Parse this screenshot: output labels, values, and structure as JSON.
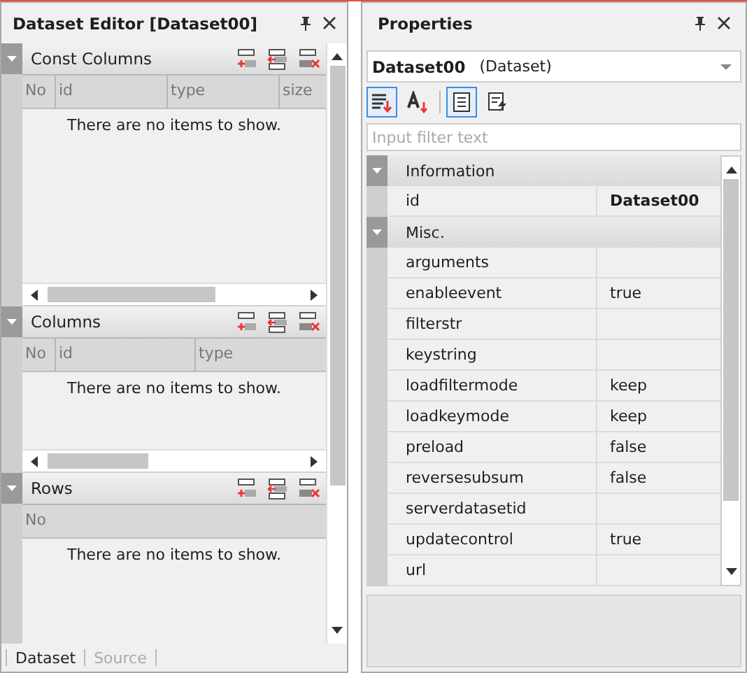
{
  "dataset_editor": {
    "title": "Dataset Editor [Dataset00]",
    "sections": [
      {
        "title": "Const Columns",
        "expanded": true,
        "columns": [
          "No",
          "id",
          "type",
          "size"
        ],
        "empty_text": "There are no items to show."
      },
      {
        "title": "Columns",
        "expanded": true,
        "columns": [
          "No",
          "id",
          "type"
        ],
        "empty_text": "There are no items to show."
      },
      {
        "title": "Rows",
        "expanded": true,
        "columns": [
          "No"
        ],
        "empty_text": "There are no items to show."
      }
    ],
    "tabs": [
      {
        "label": "Dataset",
        "selected": true
      },
      {
        "label": "Source",
        "selected": false
      }
    ]
  },
  "properties": {
    "title": "Properties",
    "object": {
      "name": "Dataset00",
      "type": "(Dataset)"
    },
    "toolbar": [
      {
        "kind": "categorized",
        "selected": true
      },
      {
        "kind": "alphabetical",
        "selected": false
      },
      {
        "kind": "properties",
        "selected": true
      },
      {
        "kind": "events",
        "selected": false
      }
    ],
    "filter": {
      "placeholder": "Input filter text"
    },
    "categories": [
      {
        "name": "Information",
        "expanded": true,
        "rows": [
          {
            "name": "id",
            "value": "Dataset00",
            "bold": true
          }
        ]
      },
      {
        "name": "Misc.",
        "expanded": true,
        "rows": [
          {
            "name": "arguments",
            "value": ""
          },
          {
            "name": "enableevent",
            "value": "true"
          },
          {
            "name": "filterstr",
            "value": ""
          },
          {
            "name": "keystring",
            "value": ""
          },
          {
            "name": "loadfiltermode",
            "value": "keep"
          },
          {
            "name": "loadkeymode",
            "value": "keep"
          },
          {
            "name": "preload",
            "value": "false"
          },
          {
            "name": "reversesubsum",
            "value": "false"
          },
          {
            "name": "serverdatasetid",
            "value": ""
          },
          {
            "name": "updatecontrol",
            "value": "true"
          },
          {
            "name": "url",
            "value": ""
          }
        ]
      }
    ]
  }
}
